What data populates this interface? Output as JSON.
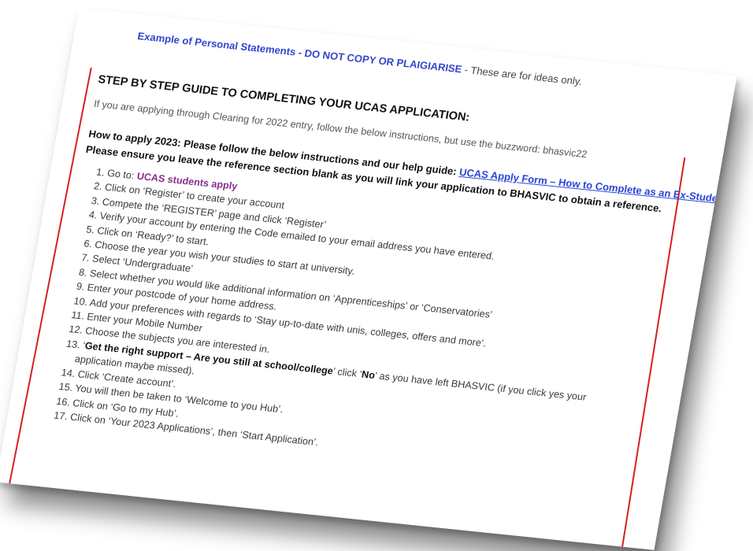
{
  "top_line": {
    "link_text": "Example of Personal Statements - DO NOT COPY OR PLAIGIARISE",
    "suffix": " - These are for ideas only."
  },
  "heading": "STEP BY STEP GUIDE TO COMPLETING YOUR UCAS APPLICATION:",
  "clearing_note": "If you are applying through Clearing for 2022 entry, follow the below instructions, but use the buzzword: bhasvic22",
  "how_to_apply": {
    "text": "How to apply 2023:  Please follow the below instructions and our help guide: ",
    "link_text": "UCAS Apply Form – How to Complete as an Ex-Student."
  },
  "ensure_note": "Please ensure you leave the reference section blank as you will link your application to BHASVIC to obtain a reference.",
  "steps": {
    "s1_prefix": "1. Go to: ",
    "s1_link": "UCAS students apply",
    "s2": "2. Click on ‘Register’ to create your account",
    "s3": "3. Compete the ‘REGISTER’ page and click ‘Register’",
    "s4": "4. Verify your account by entering the Code emailed to your email address you have entered.",
    "s5": "5. Click on ‘Ready?’ to start.",
    "s6": "6. Choose the year you wish your studies to start at university.",
    "s7": "7. Select ‘Undergraduate’",
    "s8": "8. Select whether you would like additional information on ‘Apprenticeships’ or ‘Conservatories’",
    "s9": "9. Enter your postcode of your home address.",
    "s10": "10. Add your preferences with regards to ‘Stay up-to-date with unis, colleges, offers and more’.",
    "s11": "11. Enter your Mobile Number",
    "s12": "12. Choose the subjects you are interested in.",
    "s13_a": "13. ‘",
    "s13_bold": "Get the right support – Are you still at school/college",
    "s13_b": "’ click ‘",
    "s13_no": "No",
    "s13_c": "’ as you have left BHASVIC (if you click yes your",
    "s13_cont": "application maybe missed).",
    "s14": "14. Click ‘Create account’.",
    "s15": "15. You will then be taken to ‘Welcome to you Hub’.",
    "s16": "16. Click on ‘Go to my Hub’.",
    "s17": "17. Click on ‘Your 2023 Applications’, then ‘Start Application’."
  },
  "colors": {
    "link_blue": "#2a45d8",
    "ucas_purple": "#8a2f8a",
    "margin_red": "#d62020"
  }
}
